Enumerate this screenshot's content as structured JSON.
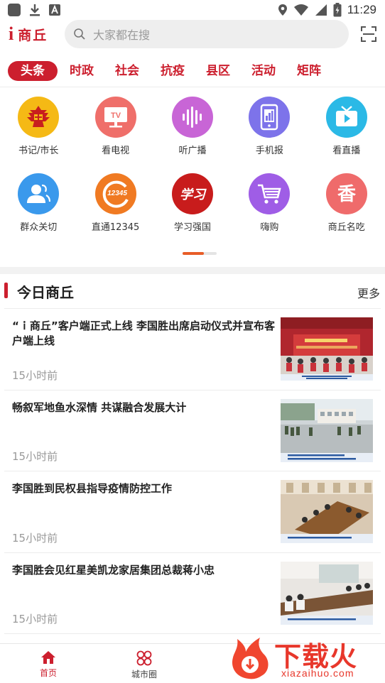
{
  "status_bar": {
    "time": "11:29"
  },
  "header": {
    "logo_i": "i",
    "logo_text": "商丘",
    "search_placeholder": "大家都在搜"
  },
  "tabs": [
    "头条",
    "时政",
    "社会",
    "抗疫",
    "县区",
    "活动",
    "矩阵"
  ],
  "grid": {
    "row1": [
      {
        "label": "书记/市长",
        "icon": "emblem-icon",
        "color": "#f5b915"
      },
      {
        "label": "看电视",
        "icon": "tv-icon",
        "color": "#ef6f6a"
      },
      {
        "label": "听广播",
        "icon": "audio-wave-icon",
        "color": "#c865d6"
      },
      {
        "label": "手机报",
        "icon": "phone-icon",
        "color": "#7d73ea"
      },
      {
        "label": "看直播",
        "icon": "live-tv-icon",
        "color": "#2bb9e6"
      }
    ],
    "row2": [
      {
        "label": "群众关切",
        "icon": "people-icon",
        "color": "#3a99ec"
      },
      {
        "label": "直通12345",
        "icon": "hotline-icon",
        "color": "#f07a22"
      },
      {
        "label": "学习强国",
        "icon": "study-icon",
        "color": "#c81c1c"
      },
      {
        "label": "嗨购",
        "icon": "cart-icon",
        "color": "#9f5de6"
      },
      {
        "label": "商丘名吃",
        "icon": "food-icon",
        "color": "#ef6b6b"
      }
    ],
    "hotline_badge": "12345",
    "food_glyph": "香",
    "study_glyph": "学习"
  },
  "section": {
    "title": "今日商丘",
    "more": "更多"
  },
  "news": [
    {
      "title": "“ｉ商丘”客户端正式上线 李国胜出席启动仪式并宣布客户端上线",
      "time": "15小时前",
      "thumb": "launch-ceremony-photo"
    },
    {
      "title": "畅叙军地鱼水深情 共谋融合发展大计",
      "time": "15小时前",
      "thumb": "military-visit-photo"
    },
    {
      "title": "李国胜到民权县指导疫情防控工作",
      "time": "15小时前",
      "thumb": "meeting-room-photo"
    },
    {
      "title": "李国胜会见红星美凯龙家居集团总裁蒋小忠",
      "time": "15小时前",
      "thumb": "conference-photo"
    }
  ],
  "bottom_nav": [
    {
      "label": "首页"
    },
    {
      "label": "城市圈"
    }
  ],
  "watermark": {
    "text": "下载火",
    "sub": "xiazaihuo.com"
  }
}
